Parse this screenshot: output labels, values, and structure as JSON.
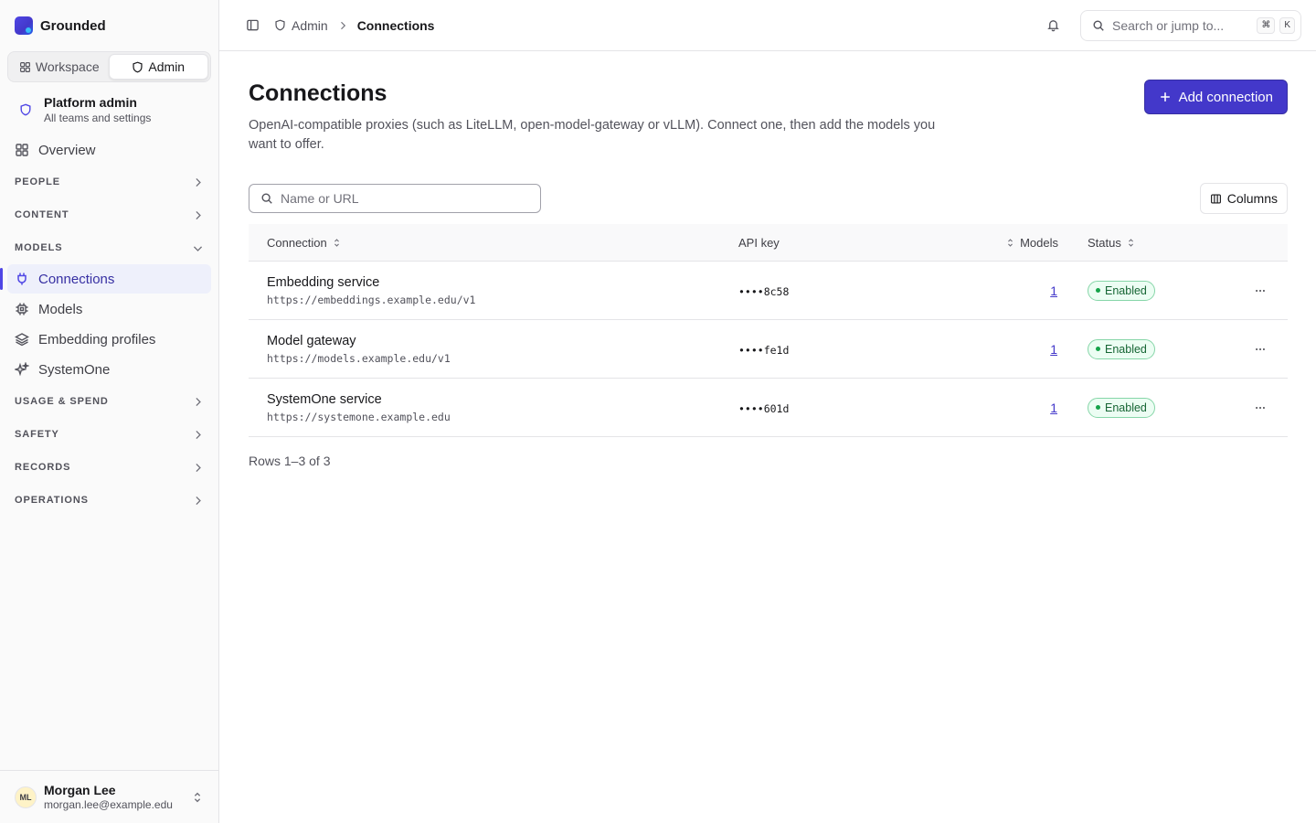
{
  "brand": {
    "name": "Grounded"
  },
  "switcher": {
    "workspace": "Workspace",
    "admin": "Admin"
  },
  "context": {
    "title": "Platform admin",
    "subtitle": "All teams and settings"
  },
  "nav": {
    "overview": "Overview",
    "groups": {
      "people": "PEOPLE",
      "content": "CONTENT",
      "models": "MODELS",
      "usage": "USAGE & SPEND",
      "safety": "SAFETY",
      "records": "RECORDS",
      "operations": "OPERATIONS"
    },
    "models_items": [
      {
        "label": "Connections",
        "icon": "plug-icon",
        "active": true
      },
      {
        "label": "Models",
        "icon": "chip-icon",
        "active": false
      },
      {
        "label": "Embedding profiles",
        "icon": "layers-icon",
        "active": false
      },
      {
        "label": "SystemOne",
        "icon": "sparkles-icon",
        "active": false
      }
    ]
  },
  "user": {
    "initials": "ML",
    "name": "Morgan Lee",
    "email": "morgan.lee@example.edu"
  },
  "topbar": {
    "breadcrumb": {
      "parent": "Admin",
      "current": "Connections"
    },
    "search": {
      "placeholder": "Search or jump to...",
      "kbd1": "⌘",
      "kbd2": "K"
    }
  },
  "page": {
    "title": "Connections",
    "description": "OpenAI-compatible proxies (such as LiteLLM, open-model-gateway or vLLM). Connect one, then add the models you want to offer.",
    "add_button": "Add connection",
    "filter_placeholder": "Name or URL",
    "columns_button": "Columns"
  },
  "table": {
    "headers": {
      "connection": "Connection",
      "api_key": "API key",
      "models": "Models",
      "status": "Status"
    },
    "rows": [
      {
        "name": "Embedding service",
        "url": "https://embeddings.example.edu/v1",
        "key": "••••8c58",
        "models": "1",
        "status": "Enabled"
      },
      {
        "name": "Model gateway",
        "url": "https://models.example.edu/v1",
        "key": "••••fe1d",
        "models": "1",
        "status": "Enabled"
      },
      {
        "name": "SystemOne service",
        "url": "https://systemone.example.edu",
        "key": "••••601d",
        "models": "1",
        "status": "Enabled"
      }
    ],
    "rows_info": "Rows 1–3 of 3"
  },
  "colors": {
    "accent": "#4338ca",
    "success": "#16a34a",
    "sidebar_bg": "#fafafa"
  }
}
